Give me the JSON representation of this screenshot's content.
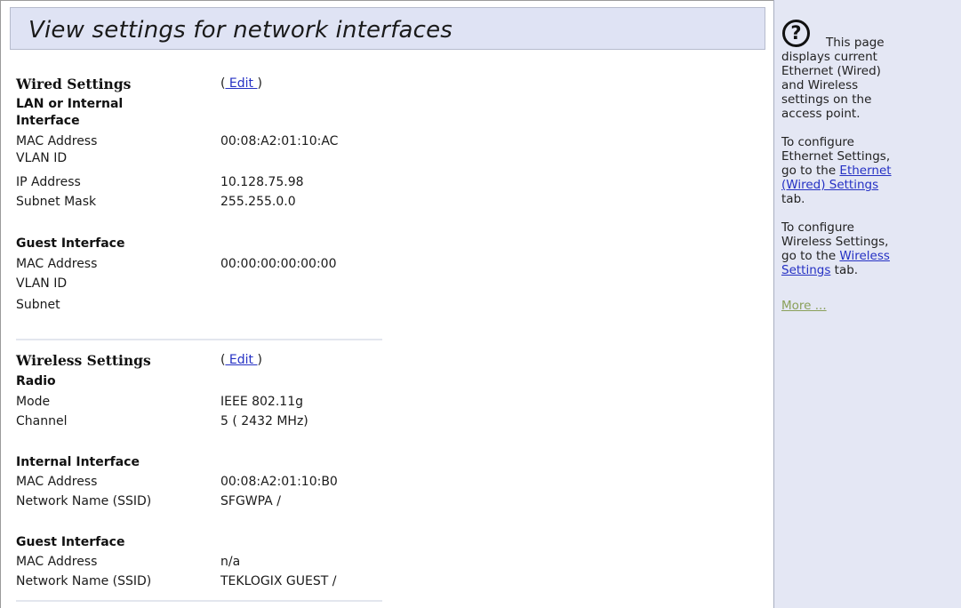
{
  "page_title": "View settings for network interfaces",
  "wired": {
    "heading": "Wired Settings",
    "edit": {
      "open": "(",
      "link": " Edit ",
      "close": ")"
    },
    "lan_heading_line1": "LAN or Internal",
    "lan_heading_line2": "Interface",
    "lan": {
      "mac_label": "MAC Address",
      "mac_value": "00:08:A2:01:10:AC",
      "vlan_label": "VLAN ID",
      "vlan_value": "",
      "ip_label": "IP Address",
      "ip_value": "10.128.75.98",
      "mask_label": "Subnet Mask",
      "mask_value": "255.255.0.0"
    },
    "guest_heading": "Guest Interface",
    "guest": {
      "mac_label": "MAC Address",
      "mac_value": "00:00:00:00:00:00",
      "vlan_label": "VLAN ID",
      "vlan_value": "",
      "subnet_label": "Subnet",
      "subnet_value": ""
    }
  },
  "wireless": {
    "heading": "Wireless Settings",
    "edit": {
      "open": "(",
      "link": " Edit ",
      "close": ")"
    },
    "radio_heading": "Radio",
    "radio": {
      "mode_label": "Mode",
      "mode_value": "IEEE 802.11g",
      "channel_label": "Channel",
      "channel_value": "5 ( 2432 MHz)"
    },
    "internal_heading": "Internal Interface",
    "internal": {
      "mac_label": "MAC Address",
      "mac_value": "00:08:A2:01:10:B0",
      "ssid_label": "Network Name (SSID)",
      "ssid_value": "SFGWPA /"
    },
    "guest_heading": "Guest Interface",
    "guest": {
      "mac_label": "MAC Address",
      "mac_value": "n/a",
      "ssid_label": "Network Name (SSID)",
      "ssid_value": "TEKLOGIX GUEST /"
    }
  },
  "help": {
    "icon": "help-question-icon",
    "p1_l1": "This page",
    "p1_l2": "displays current",
    "p1_l3": "Ethernet (Wired)",
    "p1_l4": "and Wireless",
    "p1_l5": "settings on the",
    "p1_l6": "access point.",
    "p2_l1": "To configure",
    "p2_l2": "Ethernet Settings,",
    "p2_l3_pre": "go to the ",
    "p2_link_a": "Ethernet",
    "p2_link_b": "(Wired) Settings",
    "p2_l5": "tab.",
    "p3_l1": "To configure",
    "p3_l2": "Wireless Settings,",
    "p3_l3_pre": "go to the ",
    "p3_link_a": "Wireless",
    "p3_link_b": "Settings",
    "p3_l4_post": " tab.",
    "more": "More ..."
  },
  "colors": {
    "title_bar_bg": "#dfe3f4",
    "help_panel_bg": "#e4e7f4",
    "link": "#2531c4",
    "more_link": "#8aa05a"
  }
}
